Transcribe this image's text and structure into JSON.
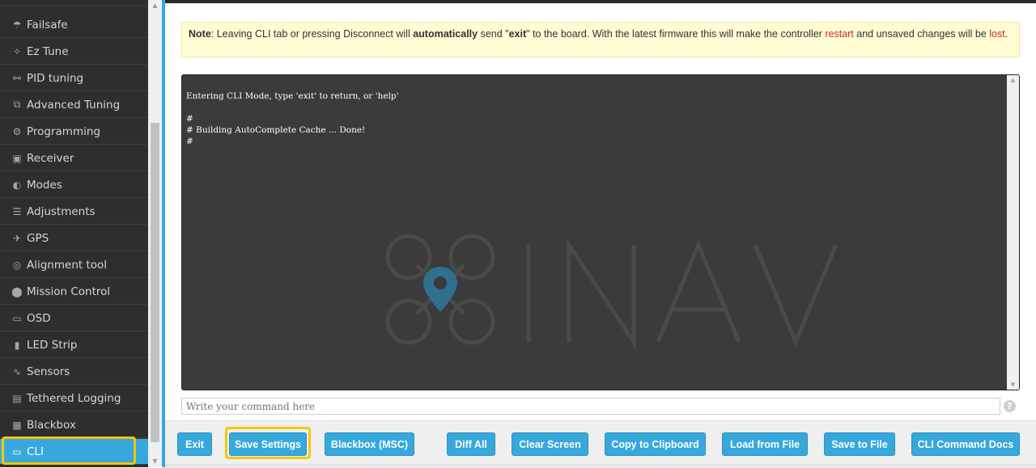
{
  "sidebar": {
    "items": [
      {
        "label": "Failsafe",
        "icon": "parachute-icon"
      },
      {
        "label": "Ez Tune",
        "icon": "magic-wand-icon"
      },
      {
        "label": "PID tuning",
        "icon": "hierarchy-icon"
      },
      {
        "label": "Advanced Tuning",
        "icon": "advanced-tree-icon"
      },
      {
        "label": "Programming",
        "icon": "gear-icon"
      },
      {
        "label": "Receiver",
        "icon": "remote-icon"
      },
      {
        "label": "Modes",
        "icon": "toggle-icon"
      },
      {
        "label": "Adjustments",
        "icon": "sliders-icon"
      },
      {
        "label": "GPS",
        "icon": "satellite-icon"
      },
      {
        "label": "Alignment tool",
        "icon": "compass-icon"
      },
      {
        "label": "Mission Control",
        "icon": "map-pin-icon"
      },
      {
        "label": "OSD",
        "icon": "osd-icon"
      },
      {
        "label": "LED Strip",
        "icon": "led-icon"
      },
      {
        "label": "Sensors",
        "icon": "pulse-icon"
      },
      {
        "label": "Tethered Logging",
        "icon": "tethered-log-icon"
      },
      {
        "label": "Blackbox",
        "icon": "blackbox-icon"
      },
      {
        "label": "CLI",
        "icon": "terminal-window-icon",
        "active": true
      }
    ]
  },
  "note": {
    "label": "Note",
    "text1": ": Leaving CLI tab or pressing Disconnect will ",
    "bold1": "automatically",
    "text2": " send \"",
    "bold2": "exit",
    "text3": "\" to the board. With the latest firmware this will make the controller ",
    "red1": "restart",
    "text4": " and unsaved changes will be ",
    "red2": "lost",
    "text5": "."
  },
  "console": {
    "lines": [
      "Entering CLI Mode, type 'exit' to return, or 'help'",
      "",
      "#",
      "# Building AutoComplete Cache ... Done!",
      "#"
    ],
    "watermark": "INAV"
  },
  "command": {
    "placeholder": "Write your command here"
  },
  "buttons": {
    "exit": "Exit",
    "save_settings": "Save Settings",
    "blackbox_msc": "Blackbox (MSC)",
    "diff_all": "Diff All",
    "clear_screen": "Clear Screen",
    "copy_clipboard": "Copy to Clipboard",
    "load_file": "Load from File",
    "save_file": "Save to File",
    "cli_docs": "CLI Command Docs"
  },
  "colors": {
    "accent": "#37a8db",
    "highlight": "#f7c600",
    "sidebar_bg": "#2e2e2e",
    "console_bg": "#3b3b3b"
  }
}
